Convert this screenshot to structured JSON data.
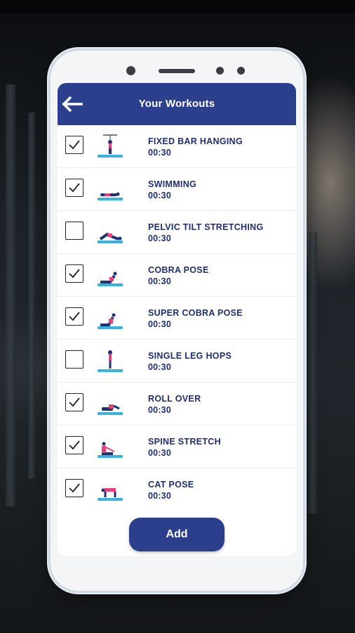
{
  "header": {
    "title": "Your Workouts"
  },
  "workouts": [
    {
      "name": "FIXED BAR HANGING",
      "duration": "00:30",
      "checked": true
    },
    {
      "name": "SWIMMING",
      "duration": "00:30",
      "checked": true
    },
    {
      "name": "PELVIC TILT STRETCHING",
      "duration": "00:30",
      "checked": false
    },
    {
      "name": "COBRA POSE",
      "duration": "00:30",
      "checked": true
    },
    {
      "name": "SUPER COBRA POSE",
      "duration": "00:30",
      "checked": true
    },
    {
      "name": "SINGLE LEG HOPS",
      "duration": "00:30",
      "checked": false
    },
    {
      "name": "ROLL OVER",
      "duration": "00:30",
      "checked": true
    },
    {
      "name": "SPINE STRETCH",
      "duration": "00:30",
      "checked": true
    },
    {
      "name": "CAT POSE",
      "duration": "00:30",
      "checked": true
    }
  ],
  "actions": {
    "add_label": "Add"
  },
  "colors": {
    "primary": "#2b3f8c",
    "text": "#1f2f70",
    "mat": "#36b3e0",
    "figure_top": "#e8407a",
    "figure_bottom": "#1f2f70"
  },
  "icons": {
    "back": "back-arrow-icon",
    "check": "checkmark-icon"
  }
}
